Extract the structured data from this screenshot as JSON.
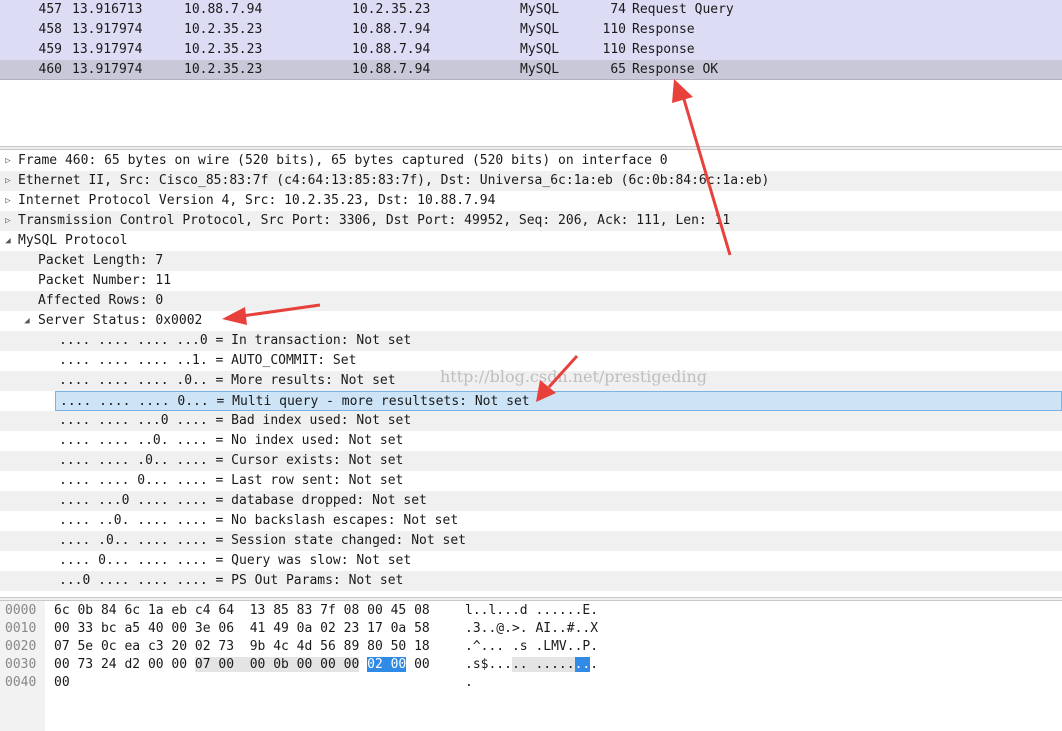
{
  "packet_list": {
    "rows": [
      {
        "no": "457",
        "time": "13.916713",
        "src": "10.88.7.94",
        "dst": "10.2.35.23",
        "proto": "MySQL",
        "len": "74",
        "info": "Request Query"
      },
      {
        "no": "458",
        "time": "13.917974",
        "src": "10.2.35.23",
        "dst": "10.88.7.94",
        "proto": "MySQL",
        "len": "110",
        "info": "Response"
      },
      {
        "no": "459",
        "time": "13.917974",
        "src": "10.2.35.23",
        "dst": "10.88.7.94",
        "proto": "MySQL",
        "len": "110",
        "info": "Response"
      },
      {
        "no": "460",
        "time": "13.917974",
        "src": "10.2.35.23",
        "dst": "10.88.7.94",
        "proto": "MySQL",
        "len": "65",
        "info": "Response OK"
      }
    ],
    "selected_index": 3
  },
  "details": {
    "rows": [
      {
        "toggle": "▷",
        "text": "Frame 460: 65 bytes on wire (520 bits), 65 bytes captured (520 bits) on interface 0"
      },
      {
        "toggle": "▷",
        "text": "Ethernet II, Src: Cisco_85:83:7f (c4:64:13:85:83:7f), Dst: Universa_6c:1a:eb (6c:0b:84:6c:1a:eb)"
      },
      {
        "toggle": "▷",
        "text": "Internet Protocol Version 4, Src: 10.2.35.23, Dst: 10.88.7.94"
      },
      {
        "toggle": "▷",
        "text": "Transmission Control Protocol, Src Port: 3306, Dst Port: 49952, Seq: 206, Ack: 111, Len: 11"
      },
      {
        "toggle": "◢",
        "text": "MySQL Protocol"
      },
      {
        "toggle": "",
        "text": "Packet Length: 7"
      },
      {
        "toggle": "",
        "text": "Packet Number: 11"
      },
      {
        "toggle": "",
        "text": "Affected Rows: 0"
      },
      {
        "toggle": "◢",
        "text": "Server Status: 0x0002"
      },
      {
        "toggle": "",
        "text": ".... .... .... ...0 = In transaction: Not set"
      },
      {
        "toggle": "",
        "text": ".... .... .... ..1. = AUTO_COMMIT: Set"
      },
      {
        "toggle": "",
        "text": ".... .... .... .0.. = More results: Not set"
      },
      {
        "toggle": "",
        "text": ".... .... .... 0... = Multi query - more resultsets: Not set"
      },
      {
        "toggle": "",
        "text": ".... .... ...0 .... = Bad index used: Not set"
      },
      {
        "toggle": "",
        "text": ".... .... ..0. .... = No index used: Not set"
      },
      {
        "toggle": "",
        "text": ".... .... .0.. .... = Cursor exists: Not set"
      },
      {
        "toggle": "",
        "text": ".... .... 0... .... = Last row sent: Not set"
      },
      {
        "toggle": "",
        "text": ".... ...0 .... .... = database dropped: Not set"
      },
      {
        "toggle": "",
        "text": ".... ..0. .... .... = No backslash escapes: Not set"
      },
      {
        "toggle": "",
        "text": ".... .0.. .... .... = Session state changed: Not set"
      },
      {
        "toggle": "",
        "text": ".... 0... .... .... = Query was slow: Not set"
      },
      {
        "toggle": "",
        "text": "...0 .... .... .... = PS Out Params: Not set"
      }
    ],
    "selected_index": 12
  },
  "hex": {
    "lines": [
      {
        "offset": "0000",
        "bytes": [
          "6c",
          "0b",
          "84",
          "6c",
          "1a",
          "eb",
          "c4",
          "64",
          "13",
          "85",
          "83",
          "7f",
          "08",
          "00",
          "45",
          "08"
        ],
        "ascii": "l..l...d ......E."
      },
      {
        "offset": "0010",
        "bytes": [
          "00",
          "33",
          "bc",
          "a5",
          "40",
          "00",
          "3e",
          "06",
          "41",
          "49",
          "0a",
          "02",
          "23",
          "17",
          "0a",
          "58"
        ],
        "ascii": ".3..@.>. AI..#..X"
      },
      {
        "offset": "0020",
        "bytes": [
          "07",
          "5e",
          "0c",
          "ea",
          "c3",
          "20",
          "02",
          "73",
          "9b",
          "4c",
          "4d",
          "56",
          "89",
          "80",
          "50",
          "18"
        ],
        "ascii": ".^... .s .LMV..P."
      },
      {
        "offset": "0030",
        "bytes": [
          "00",
          "73",
          "24",
          "d2",
          "00",
          "00",
          "07",
          "00",
          "00",
          "0b",
          "00",
          "00",
          "00",
          "02",
          "00",
          "00"
        ],
        "ascii": ".s$..... ........"
      },
      {
        "offset": "0040",
        "bytes": [
          "00"
        ],
        "ascii": "."
      }
    ]
  },
  "watermark": "http://blog.csdn.net/prestigeding",
  "colors": {
    "packet_row_bg": "#dcdcf5",
    "selected_detail_bg": "#cde3f6",
    "hex_selection": "#2f8be6",
    "annotation_arrow": "#e8413c"
  }
}
